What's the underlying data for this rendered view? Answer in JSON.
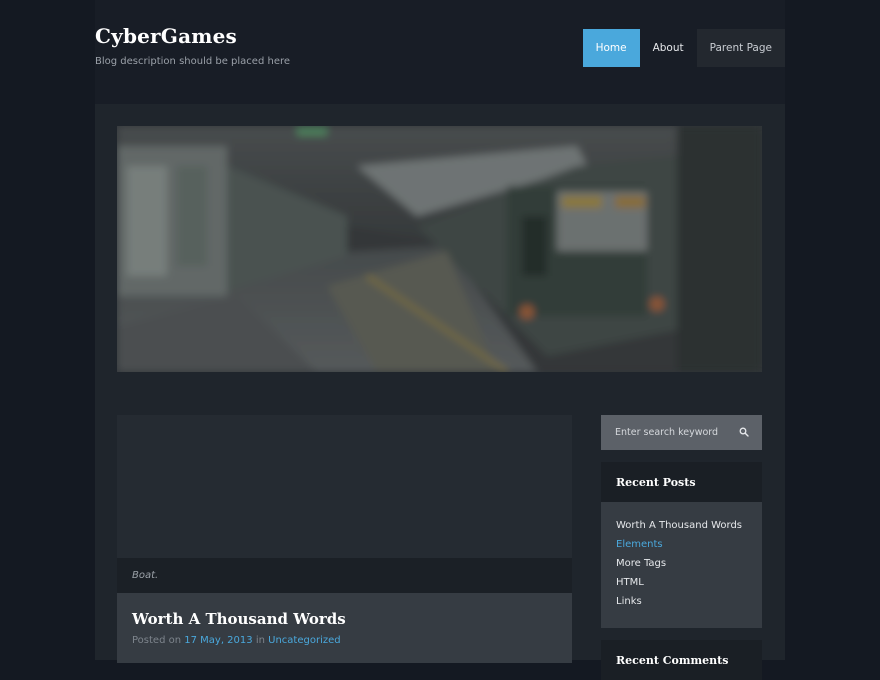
{
  "site": {
    "title": "CyberGames",
    "description": "Blog description should be placed here"
  },
  "nav": {
    "items": [
      {
        "label": "Home",
        "active": true
      },
      {
        "label": "About",
        "active": false
      },
      {
        "label": "Parent Page",
        "active": false
      }
    ]
  },
  "hero": {
    "icon": "subway-train-photo"
  },
  "post": {
    "caption": "Boat.",
    "title": "Worth A Thousand Words",
    "meta_prefix": "Posted on",
    "date": "17 May, 2013",
    "meta_in": "in",
    "category": "Uncategorized"
  },
  "sidebar": {
    "search": {
      "placeholder": "Enter search keyword",
      "icon": "search-icon"
    },
    "recent_posts": {
      "title": "Recent Posts",
      "items": [
        "Worth A Thousand Words",
        "Elements",
        "More Tags",
        "HTML",
        "Links"
      ]
    },
    "recent_comments": {
      "title": "Recent Comments"
    }
  },
  "colors": {
    "accent": "#4aa8dc",
    "background": "#141922",
    "panel": "#1f252c",
    "card": "#363c43"
  }
}
